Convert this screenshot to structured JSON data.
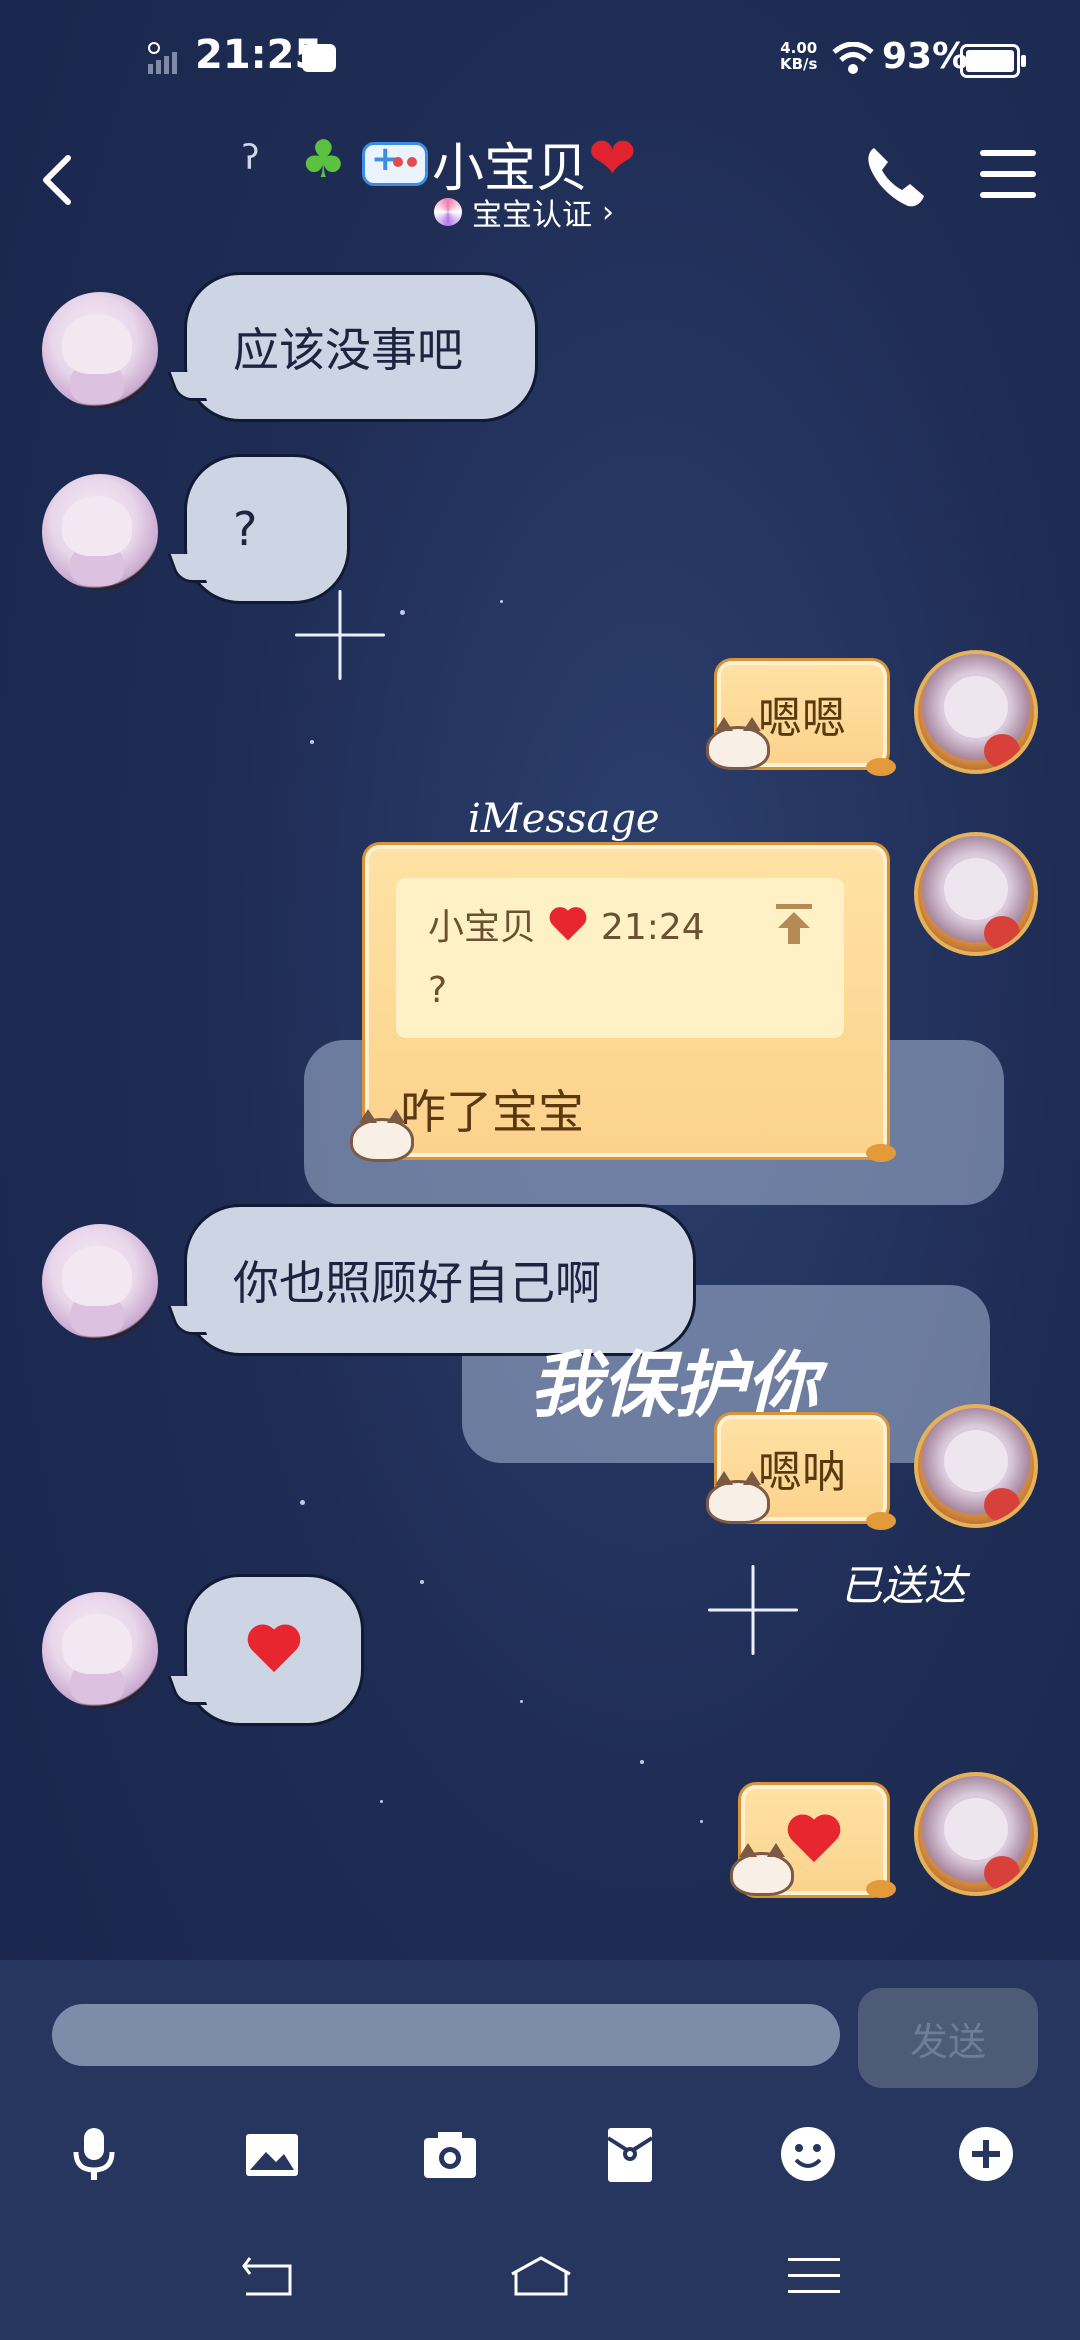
{
  "status_bar": {
    "time": "21:25",
    "net_speed_top": "4.00",
    "net_speed_bottom": "KB/s",
    "battery": "93%"
  },
  "header": {
    "title": "小宝贝",
    "subtitle": "宝宝认证"
  },
  "messages": {
    "m1": "应该没事吧",
    "m2": "?",
    "m3": "嗯嗯",
    "m4_quote_sender": "小宝贝",
    "m4_quote_time": "21:24",
    "m4_quote_text": "?",
    "m4_reply": "咋了宝宝",
    "m5": "你也照顾好自己啊",
    "m6": "嗯呐"
  },
  "wallpaper_text": {
    "imessage": "iMessage",
    "handwritten": "我保护你",
    "delivered": "已送达"
  },
  "input": {
    "placeholder": "",
    "send_label": "发送"
  },
  "colors": {
    "background": "#1f2d55",
    "bubble_left": "#cdd5e4",
    "bubble_right": "#fbd28c",
    "accent_heart": "#e8262f"
  },
  "icons": [
    "mic-icon",
    "image-icon",
    "camera-icon",
    "red-packet-icon",
    "emoji-icon",
    "plus-icon"
  ]
}
